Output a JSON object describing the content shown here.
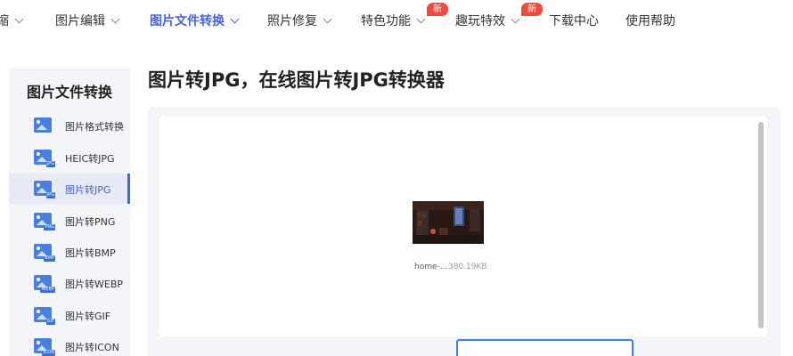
{
  "nav": {
    "items": [
      {
        "label": "缩"
      },
      {
        "label": "图片编辑"
      },
      {
        "label": "图片文件转换"
      },
      {
        "label": "照片修复"
      },
      {
        "label": "特色功能"
      },
      {
        "label": "趣玩特效"
      },
      {
        "label": "下载中心"
      },
      {
        "label": "使用帮助"
      }
    ],
    "badges": [
      "新",
      "新"
    ]
  },
  "sidebar": {
    "title": "图片文件转换",
    "items": [
      {
        "label": "图片格式转换",
        "icon": "image-format-icon",
        "tag": ""
      },
      {
        "label": "HEIC转JPG",
        "icon": "heic-jpg-icon",
        "tag": "JPG"
      },
      {
        "label": "图片转JPG",
        "icon": "image-to-jpg-icon",
        "tag": "JPG"
      },
      {
        "label": "图片转PNG",
        "icon": "image-to-png-icon",
        "tag": "PNG"
      },
      {
        "label": "图片转BMP",
        "icon": "image-to-bmp-icon",
        "tag": "BMP"
      },
      {
        "label": "图片转WEBP",
        "icon": "image-to-webp-icon",
        "tag": "WEBP"
      },
      {
        "label": "图片转GIF",
        "icon": "image-to-gif-icon",
        "tag": "GIF"
      },
      {
        "label": "图片转ICON",
        "icon": "image-to-icon-icon",
        "tag": "ICON"
      }
    ],
    "active_index": 2
  },
  "main": {
    "title": "图片转JPG，在线图片转JPG转换器",
    "file": {
      "name": "home-...",
      "size": "380.19KB"
    }
  },
  "colors": {
    "accent": "#4a63d8",
    "badge": "#f04a3e",
    "icon_blue": "#4a7fe0",
    "button_border": "#3d7ef0"
  }
}
